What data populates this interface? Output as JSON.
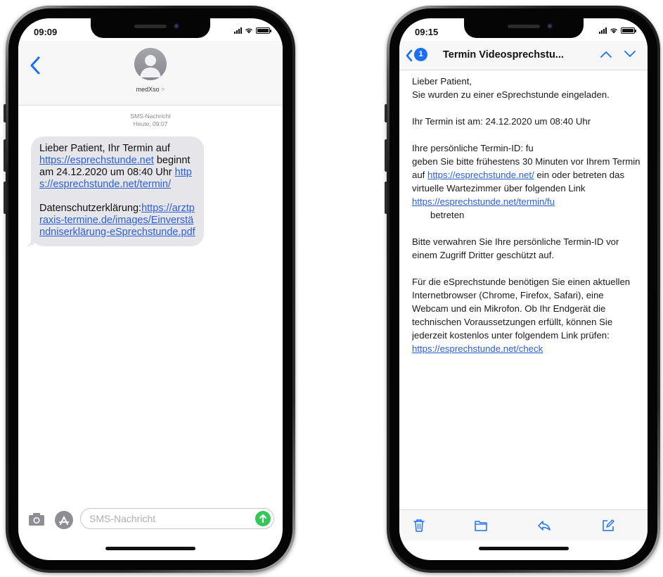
{
  "colors": {
    "accent": "#2a5fd8",
    "ios_blue": "#1a6ff5",
    "send_green": "#34c759",
    "bubble_gray": "#e6e6ea"
  },
  "left_phone": {
    "status": {
      "time": "09:09"
    },
    "header": {
      "back_icon": "chevron-left-icon",
      "avatar_icon": "person-avatar-icon",
      "contact_name": "medXso",
      "contact_chevron": ">"
    },
    "meta": {
      "channel": "SMS-Nachricht",
      "timestamp": "Heute, 09:07"
    },
    "message": {
      "line1": "Lieber Patient,  Ihr Termin auf ",
      "link1": "https://esprechstunde.net",
      "line2": " beginnt am 24.12.2020 um 08:40 Uhr ",
      "link2": "https://esprechstunde.net/termin/",
      "privacy_label": "Datenschutzerklärung:",
      "link3": "https://arztpraxis-termine.de/images/Einverständniserklärung-eSprechstunde.pdf"
    },
    "input": {
      "placeholder": "SMS-Nachricht",
      "camera_icon": "camera-icon",
      "apps_icon": "appstore-icon",
      "send_icon": "send-arrow-icon"
    }
  },
  "right_phone": {
    "status": {
      "time": "09:15"
    },
    "nav": {
      "unread_count": "1",
      "title": "Termin Videosprechstu...",
      "up_icon": "chevron-up-icon",
      "down_icon": "chevron-down-icon"
    },
    "body": {
      "greeting": "Lieber Patient,",
      "invite": "Sie wurden zu einer eSprechstunde eingeladen.",
      "date_line": "Ihr Termin ist am: 24.12.2020 um 08:40 Uhr",
      "id_line": "Ihre persönliche Termin-ID: fu",
      "instr1": "geben Sie bitte frühestens 30 Minuten vor Ihrem Termin auf ",
      "link1": "https://esprechstunde.net/",
      "instr2": " ein oder betreten das virtuelle Wartezimmer über folgenden Link ",
      "link2": "https://esprechstunde.net/termin/fu",
      "instr3": "betreten",
      "keep_safe": "Bitte verwahren Sie Ihre persönliche Termin-ID vor einem Zugriff Dritter geschützt auf.",
      "requirements": "Für die eSprechstunde benötigen Sie einen aktuellen Internetbrowser (Chrome, Firefox, Safari), eine Webcam und ein Mikrofon. Ob Ihr Endgerät die technischen Voraussetzungen erfüllt, können Sie jederzeit kostenlos unter folgendem Link prüfen: ",
      "link3": "https://esprechstunde.net/check"
    },
    "toolbar": {
      "trash_icon": "trash-icon",
      "folder_icon": "folder-icon",
      "reply_icon": "reply-icon",
      "compose_icon": "compose-icon"
    }
  }
}
